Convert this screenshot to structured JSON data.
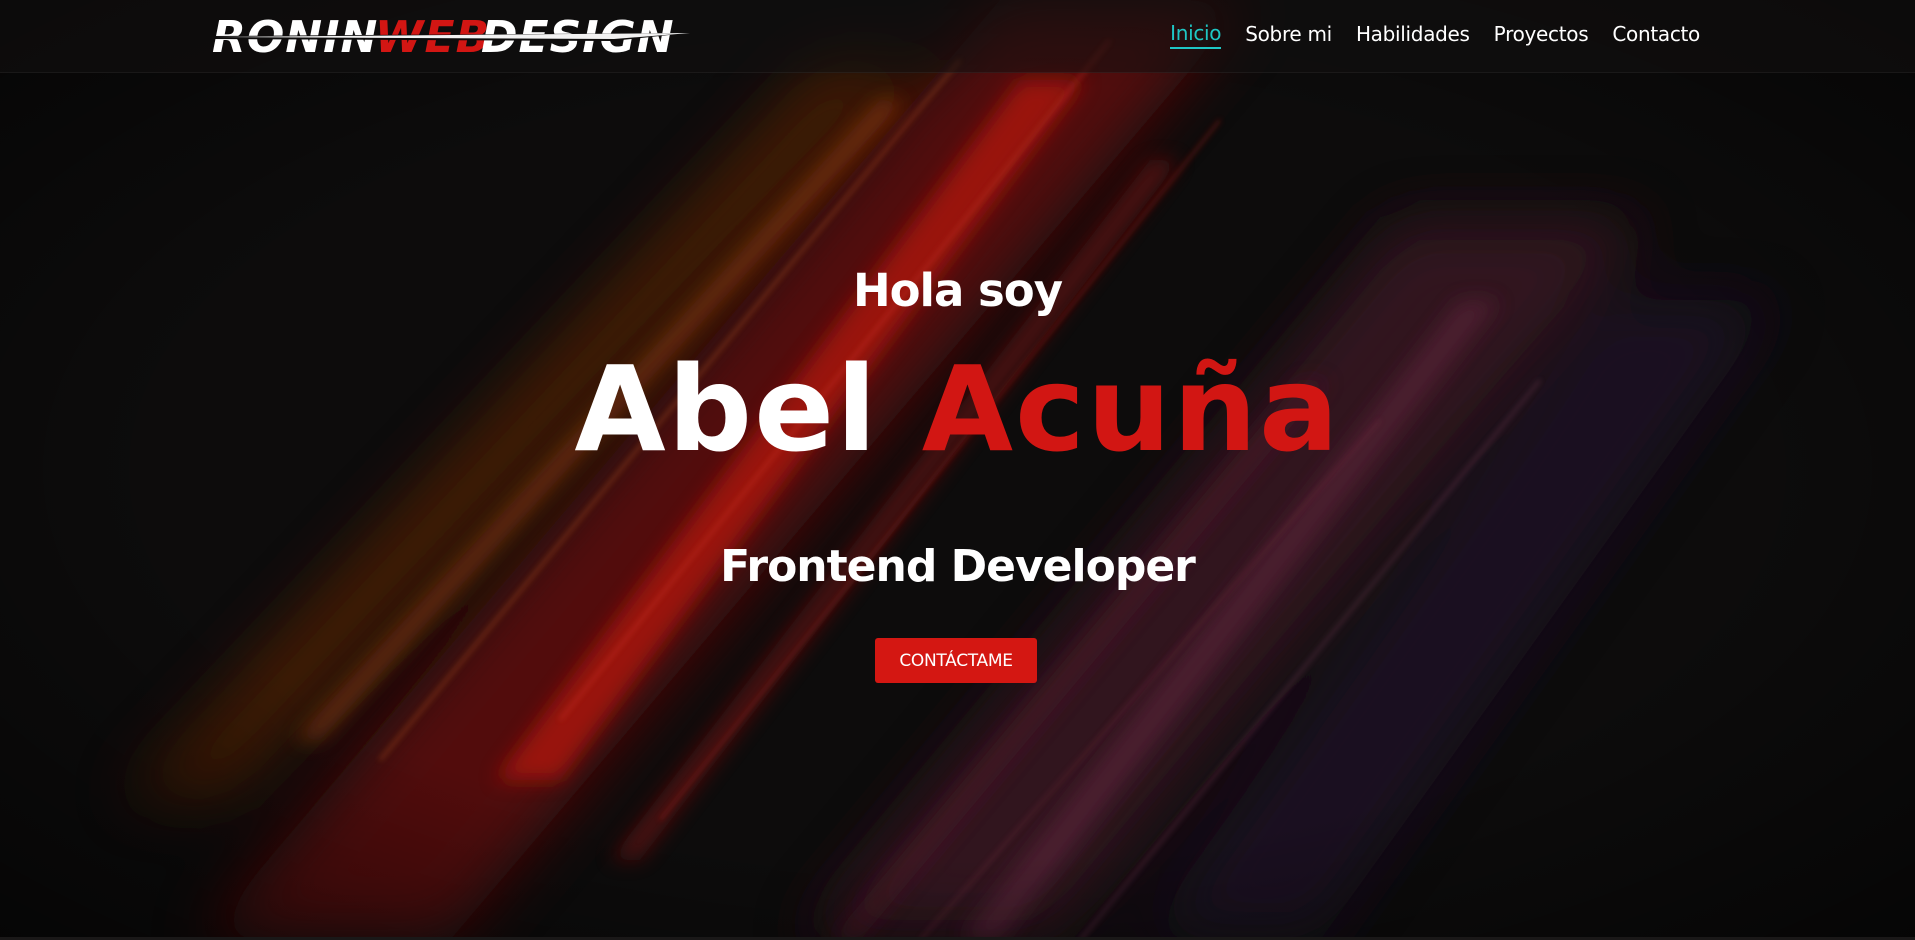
{
  "brand": {
    "logo_text_1": "RONIN",
    "logo_text_2": "WEB",
    "logo_text_3": "DESIGN",
    "accent_color": "#d21613",
    "active_color": "#1fc6c4"
  },
  "nav": {
    "items": [
      {
        "label": "Inicio",
        "active": true
      },
      {
        "label": "Sobre mi",
        "active": false
      },
      {
        "label": "Habilidades",
        "active": false
      },
      {
        "label": "Proyectos",
        "active": false
      },
      {
        "label": "Contacto",
        "active": false
      }
    ]
  },
  "hero": {
    "greeting": "Hola soy",
    "first_name": "Abel",
    "last_name": "Acuña",
    "role": "Frontend Developer",
    "cta_label": "CONTÁCTAME"
  }
}
